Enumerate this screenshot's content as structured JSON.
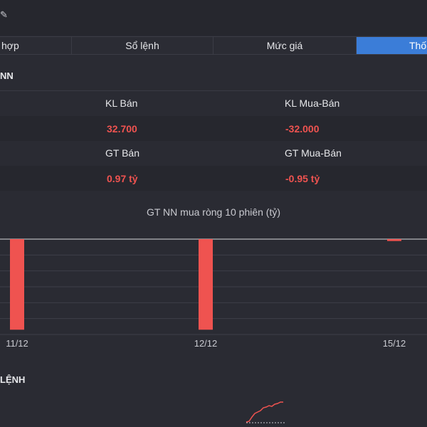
{
  "header": {
    "edit_icon": "pencil-icon"
  },
  "tabs": [
    {
      "label": "hợp",
      "active": false
    },
    {
      "label": "Sổ lệnh",
      "active": false
    },
    {
      "label": "Mức giá",
      "active": false
    },
    {
      "label": "Thố",
      "active": true
    }
  ],
  "foreign": {
    "section_title": "NN",
    "kl_ban_label": "KL Bán",
    "kl_mua_ban_label": "KL Mua-Bán",
    "kl_ban_value": "32.700",
    "kl_mua_ban_value": "-32.000",
    "gt_ban_label": "GT Bán",
    "gt_mua_ban_label": "GT Mua-Bán",
    "gt_ban_value": "0.97 tỷ",
    "gt_mua_ban_value": "-0.95 tỷ"
  },
  "chart_data": {
    "type": "bar",
    "title": "GT NN mua ròng 10 phiên (tỷ)",
    "categories": [
      "11/12",
      "12/12",
      "15/12"
    ],
    "values": [
      -0.95,
      -0.95,
      -0.02
    ],
    "ylim": [
      -1.0,
      0
    ],
    "grid": true,
    "bar_color": "#ef5350"
  },
  "orders": {
    "section_title": "LỆNH"
  },
  "colors": {
    "background": "#2a2b33",
    "accent": "#3b7dd8",
    "negative": "#ef5350"
  }
}
